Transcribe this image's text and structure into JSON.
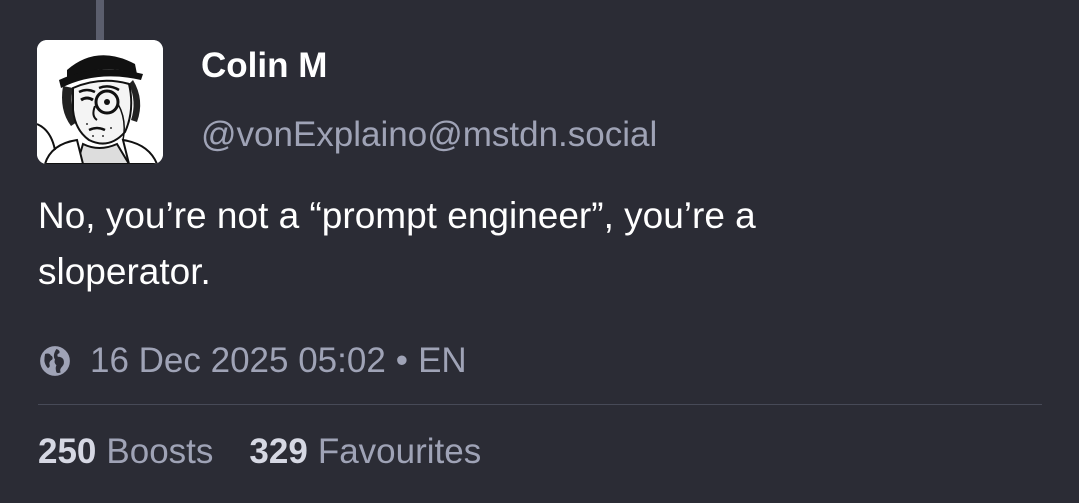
{
  "post": {
    "author": {
      "display_name": "Colin M",
      "handle": "@vonExplaino@mstdn.social",
      "avatar_icon": "avatar-illustration"
    },
    "content_lines": [
      "No, you’re not a “prompt engineer”, you’re a",
      "sloperator."
    ],
    "meta": {
      "visibility_icon": "globe-icon",
      "timestamp": "16 Dec 2025 05:02",
      "separator": "•",
      "language": "EN"
    },
    "stats": {
      "boosts_count": "250",
      "boosts_label": "Boosts",
      "favourites_count": "329",
      "favourites_label": "Favourites"
    }
  },
  "colors": {
    "background": "#2b2c35",
    "primary_text": "#ffffff",
    "secondary_text": "#9fa3b6",
    "divider": "#474a57"
  }
}
